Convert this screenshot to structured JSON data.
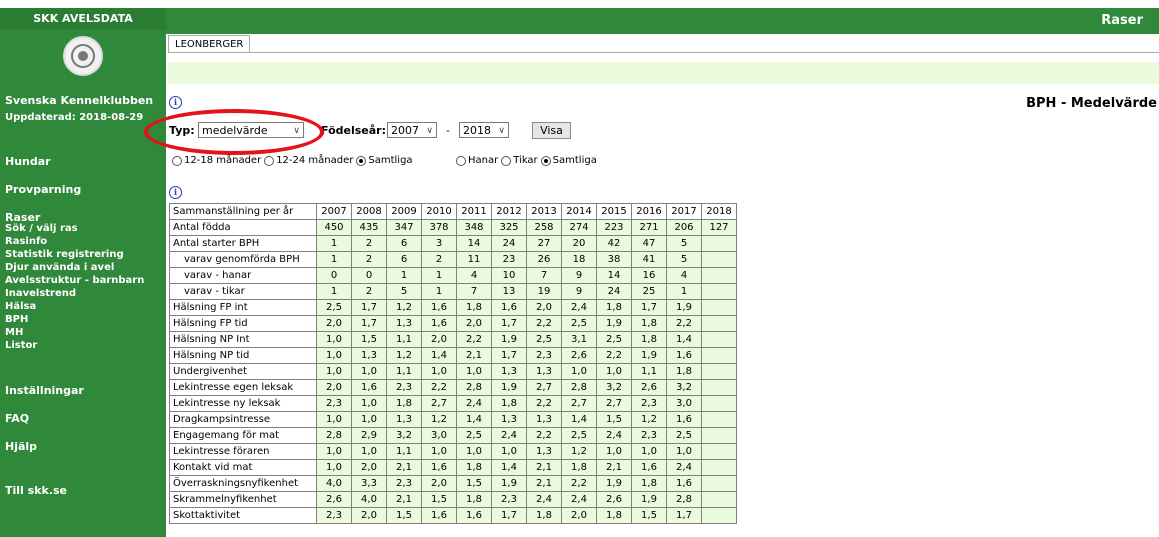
{
  "sidebar": {
    "brand": "SKK AVELSDATA",
    "org_name": "Svenska Kennelklubben",
    "updated": "Uppdaterad: 2018-08-29",
    "nav": [
      {
        "label": "Hundar",
        "type": "main"
      },
      {
        "label": "Provparning",
        "type": "main"
      },
      {
        "label": "Raser",
        "type": "main"
      },
      {
        "label": "Sök / välj ras",
        "type": "sub"
      },
      {
        "label": "Rasinfo",
        "type": "sub"
      },
      {
        "label": "Statistik registrering",
        "type": "sub"
      },
      {
        "label": "Djur använda i avel",
        "type": "sub"
      },
      {
        "label": "Avelsstruktur - barnbarn",
        "type": "sub"
      },
      {
        "label": "Inavelstrend",
        "type": "sub"
      },
      {
        "label": "Hälsa",
        "type": "sub"
      },
      {
        "label": "BPH",
        "type": "sub"
      },
      {
        "label": "MH",
        "type": "sub"
      },
      {
        "label": "Listor",
        "type": "sub"
      },
      {
        "label": "Inställningar",
        "type": "main"
      },
      {
        "label": "FAQ",
        "type": "main"
      },
      {
        "label": "Hjälp",
        "type": "main"
      },
      {
        "label": "Till skk.se",
        "type": "main"
      }
    ]
  },
  "header": {
    "section_title": "Raser",
    "tab_label": "LEONBERGER",
    "page_heading": "BPH - Medelvärde"
  },
  "filters": {
    "typ_label": "Typ:",
    "typ_value": "medelvärde",
    "fodelsear_label": "Födelseår:",
    "from_year": "2007",
    "separator": "-",
    "to_year": "2018",
    "visa_label": "Visa",
    "age_options": [
      {
        "label": "12-18 månader",
        "checked": false
      },
      {
        "label": "12-24 månader",
        "checked": false
      },
      {
        "label": "Samtliga",
        "checked": true
      }
    ],
    "sex_options": [
      {
        "label": "Hanar",
        "checked": false
      },
      {
        "label": "Tikar",
        "checked": false
      },
      {
        "label": "Samtliga",
        "checked": true
      }
    ]
  },
  "table": {
    "header_first": "Sammanställning per år",
    "years": [
      "2007",
      "2008",
      "2009",
      "2010",
      "2011",
      "2012",
      "2013",
      "2014",
      "2015",
      "2016",
      "2017",
      "2018"
    ],
    "rows": [
      {
        "label": "Antal födda",
        "indent": false,
        "values": [
          "450",
          "435",
          "347",
          "378",
          "348",
          "325",
          "258",
          "274",
          "223",
          "271",
          "206",
          "127"
        ]
      },
      {
        "label": "Antal starter BPH",
        "indent": false,
        "values": [
          "1",
          "2",
          "6",
          "3",
          "14",
          "24",
          "27",
          "20",
          "42",
          "47",
          "5",
          ""
        ]
      },
      {
        "label": "varav genomförda BPH",
        "indent": true,
        "values": [
          "1",
          "2",
          "6",
          "2",
          "11",
          "23",
          "26",
          "18",
          "38",
          "41",
          "5",
          ""
        ]
      },
      {
        "label": "varav - hanar",
        "indent": true,
        "values": [
          "0",
          "0",
          "1",
          "1",
          "4",
          "10",
          "7",
          "9",
          "14",
          "16",
          "4",
          ""
        ]
      },
      {
        "label": "varav - tikar",
        "indent": true,
        "values": [
          "1",
          "2",
          "5",
          "1",
          "7",
          "13",
          "19",
          "9",
          "24",
          "25",
          "1",
          ""
        ]
      },
      {
        "label": "Hälsning FP int",
        "indent": false,
        "values": [
          "2,5",
          "1,7",
          "1,2",
          "1,6",
          "1,8",
          "1,6",
          "2,0",
          "2,4",
          "1,8",
          "1,7",
          "1,9",
          ""
        ]
      },
      {
        "label": "Hälsning FP tid",
        "indent": false,
        "values": [
          "2,0",
          "1,7",
          "1,3",
          "1,6",
          "2,0",
          "1,7",
          "2,2",
          "2,5",
          "1,9",
          "1,8",
          "2,2",
          ""
        ]
      },
      {
        "label": "Hälsning NP Int",
        "indent": false,
        "values": [
          "1,0",
          "1,5",
          "1,1",
          "2,0",
          "2,2",
          "1,9",
          "2,5",
          "3,1",
          "2,5",
          "1,8",
          "1,4",
          ""
        ]
      },
      {
        "label": "Hälsning NP tid",
        "indent": false,
        "values": [
          "1,0",
          "1,3",
          "1,2",
          "1,4",
          "2,1",
          "1,7",
          "2,3",
          "2,6",
          "2,2",
          "1,9",
          "1,6",
          ""
        ]
      },
      {
        "label": "Undergivenhet",
        "indent": false,
        "values": [
          "1,0",
          "1,0",
          "1,1",
          "1,0",
          "1,0",
          "1,3",
          "1,3",
          "1,0",
          "1,0",
          "1,1",
          "1,8",
          ""
        ]
      },
      {
        "label": "Lekintresse egen leksak",
        "indent": false,
        "values": [
          "2,0",
          "1,6",
          "2,3",
          "2,2",
          "2,8",
          "1,9",
          "2,7",
          "2,8",
          "3,2",
          "2,6",
          "3,2",
          ""
        ]
      },
      {
        "label": "Lekintresse ny leksak",
        "indent": false,
        "values": [
          "2,3",
          "1,0",
          "1,8",
          "2,7",
          "2,4",
          "1,8",
          "2,2",
          "2,7",
          "2,7",
          "2,3",
          "3,0",
          ""
        ]
      },
      {
        "label": "Dragkampsintresse",
        "indent": false,
        "values": [
          "1,0",
          "1,0",
          "1,3",
          "1,2",
          "1,4",
          "1,3",
          "1,3",
          "1,4",
          "1,5",
          "1,2",
          "1,6",
          ""
        ]
      },
      {
        "label": "Engagemang för mat",
        "indent": false,
        "values": [
          "2,8",
          "2,9",
          "3,2",
          "3,0",
          "2,5",
          "2,4",
          "2,2",
          "2,5",
          "2,4",
          "2,3",
          "2,5",
          ""
        ]
      },
      {
        "label": "Lekintresse föraren",
        "indent": false,
        "values": [
          "1,0",
          "1,0",
          "1,1",
          "1,0",
          "1,0",
          "1,0",
          "1,3",
          "1,2",
          "1,0",
          "1,0",
          "1,0",
          ""
        ]
      },
      {
        "label": "Kontakt vid mat",
        "indent": false,
        "values": [
          "1,0",
          "2,0",
          "2,1",
          "1,6",
          "1,8",
          "1,4",
          "2,1",
          "1,8",
          "2,1",
          "1,6",
          "2,4",
          ""
        ]
      },
      {
        "label": "Överraskningsnyfikenhet",
        "indent": false,
        "values": [
          "4,0",
          "3,3",
          "2,3",
          "2,0",
          "1,5",
          "1,9",
          "2,1",
          "2,2",
          "1,9",
          "1,8",
          "1,6",
          ""
        ]
      },
      {
        "label": "Skrammelnyfikenhet",
        "indent": false,
        "values": [
          "2,6",
          "4,0",
          "2,1",
          "1,5",
          "1,8",
          "2,3",
          "2,4",
          "2,4",
          "2,6",
          "1,9",
          "2,8",
          ""
        ]
      },
      {
        "label": "Skottaktivitet",
        "indent": false,
        "values": [
          "2,3",
          "2,0",
          "1,5",
          "1,6",
          "1,6",
          "1,7",
          "1,8",
          "2,0",
          "1,8",
          "1,5",
          "1,7",
          ""
        ]
      }
    ]
  },
  "colors": {
    "sidebar_green": "#30883a",
    "cell_green": "#e9fbdc",
    "highlight_red": "#e4121a",
    "info_blue": "#1f3f9f"
  }
}
